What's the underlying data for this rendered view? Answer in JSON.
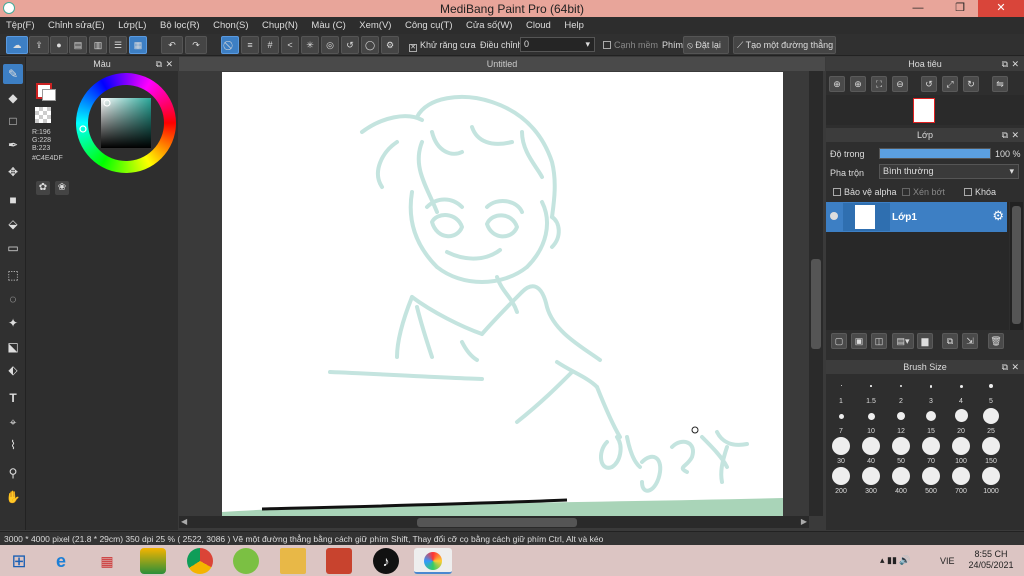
{
  "window": {
    "title": "MediBang Paint Pro (64bit)",
    "minimize": "—",
    "restore": "❐",
    "close": "✕"
  },
  "menu": [
    "Tệp(F)",
    "Chỉnh sửa(E)",
    "Lớp(L)",
    "Bộ lọc(R)",
    "Chọn(S)",
    "Chụp(N)",
    "Màu (C)",
    "Xem(V)",
    "Công cụ(T)",
    "Cửa số(W)",
    "Cloud",
    "Help"
  ],
  "toolbar": {
    "antialias_label": "Khử răng cưa",
    "adjust_label": "Điều chỉnh",
    "adjust_value": "0",
    "edge_label": "Cạnh mềm",
    "key_label": "Phím",
    "reset_label": "Đặt lại",
    "line_label": "Tạo một đường thẳng"
  },
  "color_panel": {
    "title": "Màu",
    "r": "R:196",
    "g": "G:228",
    "b": "B:223",
    "hex": "#C4E4DF",
    "main_color": "#c4e4df",
    "fg_swatch": "#cc2222"
  },
  "document": {
    "tab": "Untitled",
    "stroke_color": "#c4e4df"
  },
  "navigator": {
    "title": "Hoa tiêu"
  },
  "layer_panel": {
    "title": "Lớp",
    "opacity_label": "Độ trong",
    "opacity_value": "100 %",
    "opacity_fraction": 1.0,
    "blend_label": "Pha trộn",
    "blend_value": "Bình thường",
    "protect_alpha": "Bảo vệ alpha",
    "clip": "Xén bớt",
    "lock": "Khóa",
    "layer_name": "Lớp1"
  },
  "brush_panel": {
    "title": "Brush Size",
    "sizes": [
      "1",
      "1.5",
      "2",
      "3",
      "4",
      "5",
      "7",
      "10",
      "12",
      "15",
      "20",
      "25",
      "30",
      "40",
      "50",
      "70",
      "100",
      "150",
      "200",
      "300",
      "400",
      "500",
      "700",
      "1000"
    ]
  },
  "status": {
    "text": "3000 * 4000 pixel   (21.8 * 29cm)   350 dpi   25 %   ( 2522, 3086 )   Vẽ một đường thẳng bằng cách giữ phím Shift, Thay đổi cỡ cọ bằng cách giữ phím Ctrl, Alt và kéo"
  },
  "taskbar": {
    "lang": "VIE",
    "time": "8:55 CH",
    "date": "24/05/2021"
  }
}
